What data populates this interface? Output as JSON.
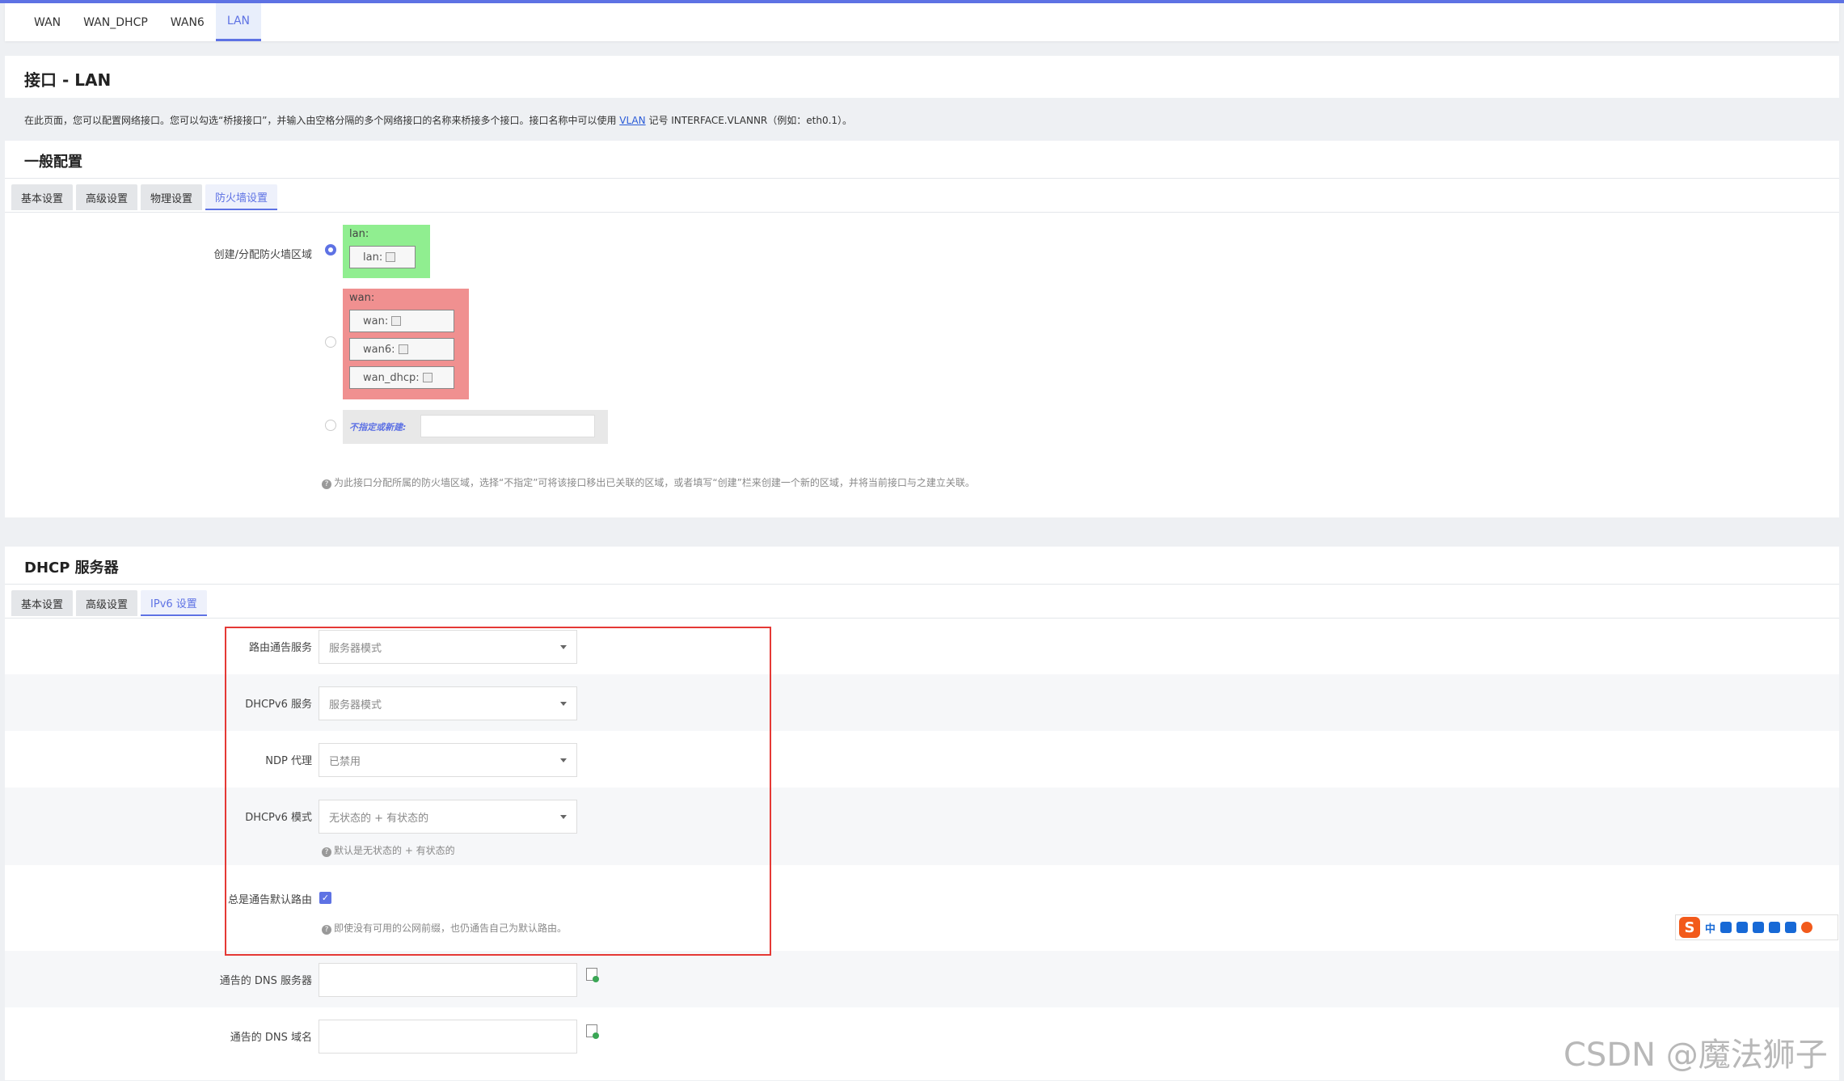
{
  "top_tabs": [
    "WAN",
    "WAN_DHCP",
    "WAN6",
    "LAN"
  ],
  "active_top_tab": "LAN",
  "page_title": "接口 - LAN",
  "description": {
    "text_before": "在此页面，您可以配置网络接口。您可以勾选“桥接接口”，并输入由空格分隔的多个网络接口的名称来桥接多个接口。接口名称中可以使用 ",
    "link": "VLAN",
    "text_after": " 记号 INTERFACE.VLANNR（例如：eth0.1）。"
  },
  "general": {
    "title": "一般配置",
    "tabs": [
      "基本设置",
      "高级设置",
      "物理设置",
      "防火墙设置"
    ],
    "active_tab": "防火墙设置",
    "firewall_label": "创建/分配防火墙区域",
    "zones": [
      {
        "name": "lan:",
        "color": "#90ee90",
        "interfaces": [
          "lan:"
        ],
        "selected": true
      },
      {
        "name": "wan:",
        "color": "#f09090",
        "interfaces": [
          "wan:",
          "wan6:",
          "wan_dhcp:"
        ],
        "selected": false
      }
    ],
    "new_zone_label": "不指定或新建:",
    "help": "为此接口分配所属的防火墙区域，选择“不指定”可将该接口移出已关联的区域，或者填写“创建”栏来创建一个新的区域，并将当前接口与之建立关联。"
  },
  "dhcp": {
    "title": "DHCP 服务器",
    "tabs": [
      "基本设置",
      "高级设置",
      "IPv6 设置"
    ],
    "active_tab": "IPv6 设置",
    "ra_label": "路由通告服务",
    "ra_value": "服务器模式",
    "dhcpv6_label": "DHCPv6 服务",
    "dhcpv6_value": "服务器模式",
    "ndp_label": "NDP 代理",
    "ndp_value": "已禁用",
    "dhcpv6_mode_label": "DHCPv6 模式",
    "dhcpv6_mode_value": "无状态的 + 有状态的",
    "dhcpv6_mode_help": "默认是无状态的 + 有状态的",
    "default_route_label": "总是通告默认路由",
    "default_route_checked": true,
    "default_route_help": "即使没有可用的公网前缀，也仍通告自己为默认路由。",
    "dns_server_label": "通告的 DNS 服务器",
    "dns_domain_label": "通告的 DNS 域名"
  },
  "ime": {
    "logo": "S",
    "lang": "中"
  },
  "watermark": "CSDN @魔法狮子"
}
